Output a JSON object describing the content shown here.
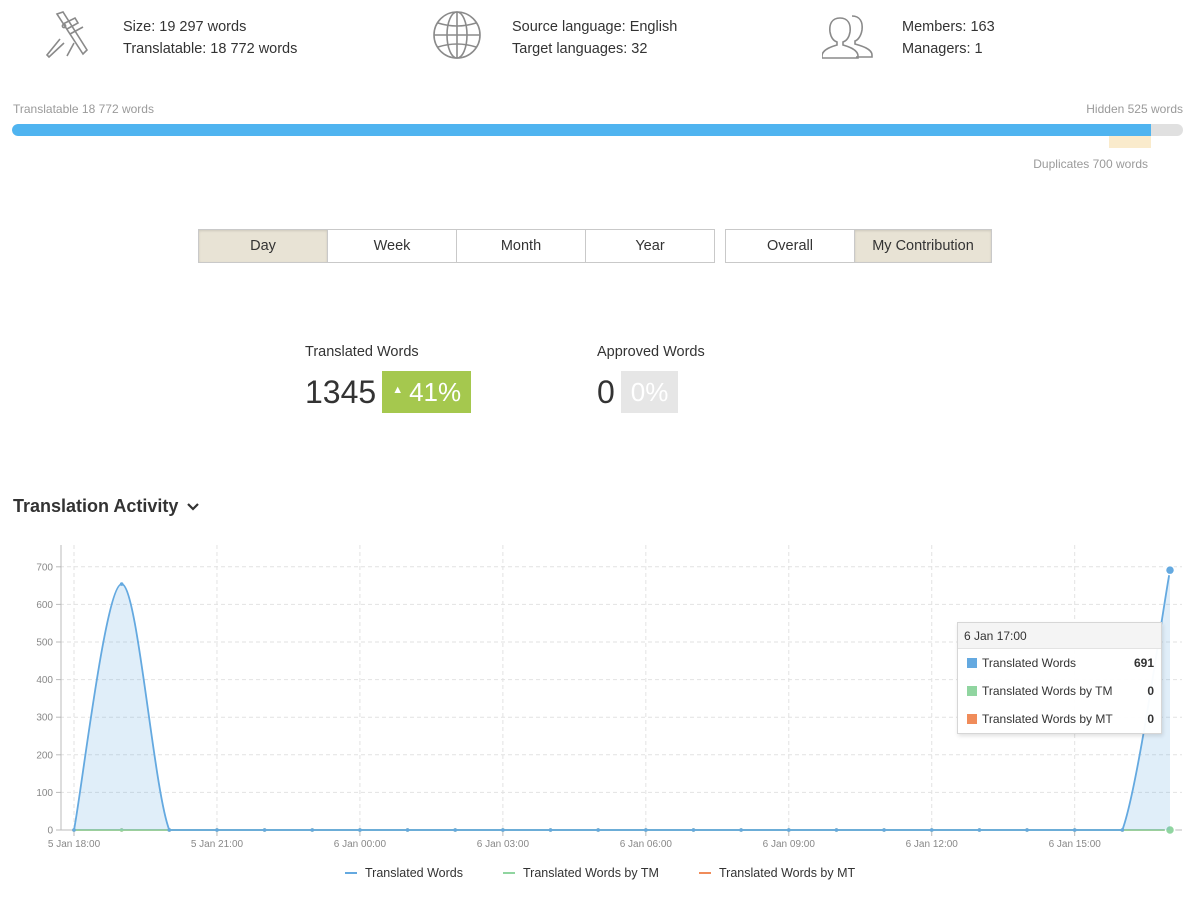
{
  "stats": {
    "size": "Size: 19 297 words",
    "translatable": "Translatable: 18 772 words",
    "source_language": "Source language: English",
    "target_languages": "Target languages: 32",
    "members": "Members: 163",
    "managers": "Managers: 1",
    "icons": [
      "calipers-icon",
      "globe-icon",
      "users-icon"
    ]
  },
  "progress": {
    "translatable_label": "Translatable 18 772 words",
    "hidden_label": "Hidden 525 words",
    "duplicates_label": "Duplicates 700 words",
    "translatable_fraction": 0.973,
    "duplicates_fraction": 0.036,
    "colors": {
      "fill": "#4fb4f0",
      "track": "#e0e0e0",
      "duplicates": "#faebcc"
    }
  },
  "period_tabs": {
    "items": [
      "Day",
      "Week",
      "Month",
      "Year"
    ],
    "active": "Day"
  },
  "scope_tabs": {
    "items": [
      "Overall",
      "My Contribution"
    ],
    "active": "My Contribution"
  },
  "metrics": {
    "translated": {
      "label": "Translated Words",
      "value": "1345",
      "change": "41%",
      "direction": "up",
      "color": "#a5c84e"
    },
    "approved": {
      "label": "Approved Words",
      "value": "0",
      "change": "0%",
      "color": "#e6e6e6"
    }
  },
  "activity": {
    "title": "Translation Activity",
    "dropdown_icon": "chevron-down-icon"
  },
  "tooltip": {
    "title": "6 Jan 17:00",
    "rows": [
      {
        "label": "Translated Words",
        "value": "691",
        "color": "#64a9e0"
      },
      {
        "label": "Translated Words by TM",
        "value": "0",
        "color": "#90d5a0"
      },
      {
        "label": "Translated Words by MT",
        "value": "0",
        "color": "#f08c5a"
      }
    ]
  },
  "chart_data": {
    "type": "area",
    "x": [
      "5 Jan 18:00",
      "5 Jan 19:00",
      "5 Jan 20:00",
      "5 Jan 21:00",
      "5 Jan 22:00",
      "5 Jan 23:00",
      "6 Jan 00:00",
      "6 Jan 01:00",
      "6 Jan 02:00",
      "6 Jan 03:00",
      "6 Jan 04:00",
      "6 Jan 05:00",
      "6 Jan 06:00",
      "6 Jan 07:00",
      "6 Jan 08:00",
      "6 Jan 09:00",
      "6 Jan 10:00",
      "6 Jan 11:00",
      "6 Jan 12:00",
      "6 Jan 13:00",
      "6 Jan 14:00",
      "6 Jan 15:00",
      "6 Jan 16:00",
      "6 Jan 17:00"
    ],
    "x_tick_labels": [
      "5 Jan 18:00",
      "5 Jan 21:00",
      "6 Jan 00:00",
      "6 Jan 03:00",
      "6 Jan 06:00",
      "6 Jan 09:00",
      "6 Jan 12:00",
      "6 Jan 15:00"
    ],
    "x_tick_step": 3,
    "y_ticks": [
      0,
      100,
      200,
      300,
      400,
      500,
      600,
      700
    ],
    "ylim": [
      0,
      750
    ],
    "series": [
      {
        "name": "Translated Words",
        "color": "#64a9e0",
        "values": [
          0,
          654,
          0,
          0,
          0,
          0,
          0,
          0,
          0,
          0,
          0,
          0,
          0,
          0,
          0,
          0,
          0,
          0,
          0,
          0,
          0,
          0,
          0,
          691
        ]
      },
      {
        "name": "Translated Words by TM",
        "color": "#90d5a0",
        "values": [
          0,
          0,
          0,
          0,
          0,
          0,
          0,
          0,
          0,
          0,
          0,
          0,
          0,
          0,
          0,
          0,
          0,
          0,
          0,
          0,
          0,
          0,
          0,
          0
        ]
      },
      {
        "name": "Translated Words by MT",
        "color": "#f08c5a",
        "values": [
          0,
          0,
          0,
          0,
          0,
          0,
          0,
          0,
          0,
          0,
          0,
          0,
          0,
          0,
          0,
          0,
          0,
          0,
          0,
          0,
          0,
          0,
          0,
          0
        ]
      }
    ],
    "grid": true,
    "legend_position": "bottom"
  }
}
